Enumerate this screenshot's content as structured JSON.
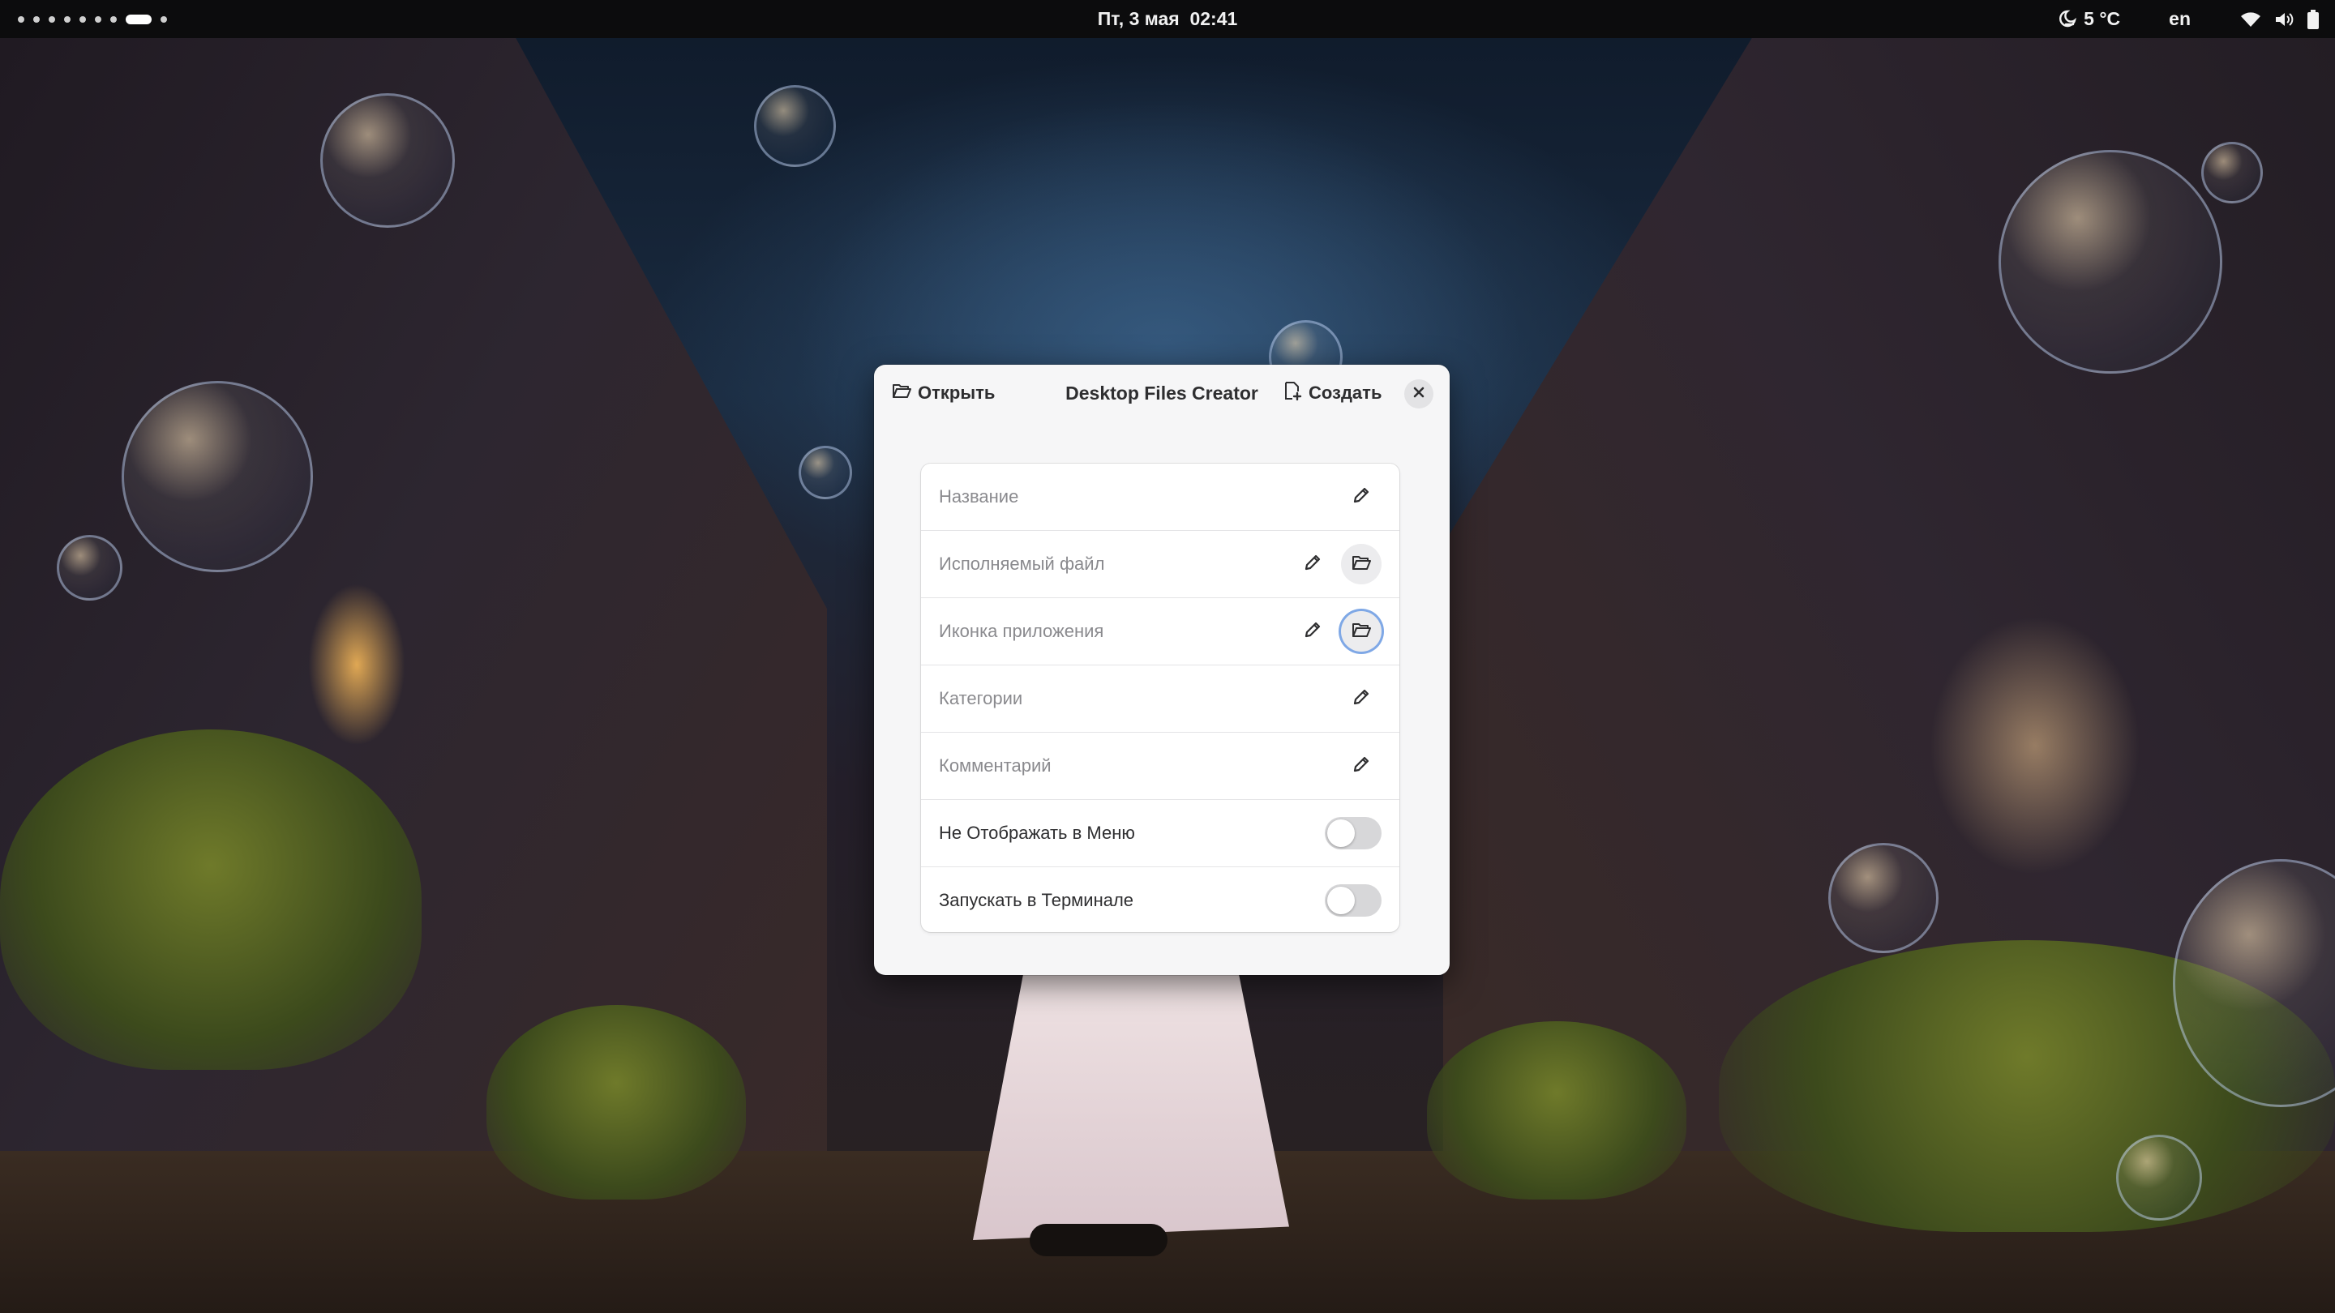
{
  "topbar": {
    "workspaces": {
      "count": 9,
      "active_index": 7
    },
    "clock": "Пт, 3 мая  02:41",
    "weather": {
      "icon": "night-weather-icon",
      "temperature": "5 °C"
    },
    "keyboard_layout": "en",
    "system_icons": [
      "wifi-icon",
      "volume-icon",
      "battery-icon"
    ]
  },
  "dialog": {
    "title": "Desktop Files Creator",
    "open_button": {
      "label": "Открыть",
      "icon": "folder-open-icon"
    },
    "create_button": {
      "label": "Создать",
      "icon": "document-new-icon"
    },
    "close_icon": "close-icon",
    "fields": [
      {
        "placeholder": "Название",
        "actions": [
          "edit-icon"
        ]
      },
      {
        "placeholder": "Исполняемый файл",
        "actions": [
          "edit-icon",
          "folder-open-icon"
        ]
      },
      {
        "placeholder": "Иконка приложения",
        "actions": [
          "edit-icon",
          "folder-open-icon"
        ],
        "focused": true
      },
      {
        "placeholder": "Категории",
        "actions": [
          "edit-icon"
        ]
      },
      {
        "placeholder": "Комментарий",
        "actions": [
          "edit-icon"
        ]
      }
    ],
    "toggles": [
      {
        "label": "Не Отображать в Меню",
        "value": false
      },
      {
        "label": "Запускать в Терминале",
        "value": false
      }
    ]
  },
  "colors": {
    "topbar_bg": "#0c0c0d",
    "dialog_bg": "#f6f6f7",
    "focus_ring": "#7fa8e6",
    "toggle_off": "#d7d7d9"
  }
}
